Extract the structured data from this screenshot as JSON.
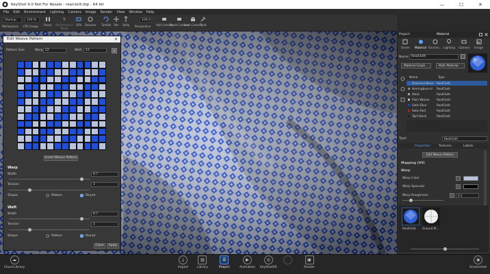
{
  "window": {
    "title": "KeyShot 9.0 Not For Resale - realcloth.bip - 64 bit",
    "minimize": "—",
    "maximize": "☐",
    "close": "✕"
  },
  "menu": [
    "File",
    "Edit",
    "Environment",
    "Lighting",
    "Camera",
    "Image",
    "Render",
    "View",
    "Window",
    "Help"
  ],
  "toolbar": {
    "workspace_value": "Startup",
    "workspace_label": "Workspaces",
    "cpu_value": "100 %",
    "cpu_label": "CPU Usage",
    "pause": "Pause",
    "performance": "Performance Mode",
    "gpu": "GPU",
    "denoise": "Denoise",
    "tumble": "Tumble",
    "pan": "Pan",
    "dolly": "Dolly",
    "fov_value": "100.0",
    "perspective": "Perspective",
    "add_camera": "Add Camera",
    "reset_camera": "Reset Camera",
    "lock_camera": "Lock Camera",
    "tools": "Tools"
  },
  "dialog": {
    "title": "Edit Weave Pattern",
    "close": "✕",
    "pattern_size_label": "Pattern Size",
    "warp_label": "Warp",
    "warp_value": "12",
    "weft_label": "Weft",
    "weft_value": "12",
    "invert_button": "Invert Weave Pattern",
    "warp_section": "Warp",
    "weft_section": "Weft",
    "width_label": "Width",
    "tension_label": "Tension",
    "shape_label": "Shape:",
    "ribbon_label": "Ribbon",
    "round_label": "Round",
    "warp_width_value": "0.7",
    "warp_tension_value": "1",
    "weft_width_value": "0.7",
    "weft_tension_value": "1",
    "close_button": "Close",
    "apply_button": "Apply",
    "grid": [
      [
        1,
        1,
        0,
        0,
        1,
        1,
        0,
        0,
        1,
        1,
        0,
        0
      ],
      [
        1,
        0,
        0,
        1,
        1,
        0,
        0,
        1,
        1,
        0,
        0,
        1
      ],
      [
        0,
        0,
        1,
        1,
        0,
        0,
        1,
        1,
        0,
        0,
        1,
        1
      ],
      [
        0,
        1,
        1,
        0,
        0,
        1,
        1,
        0,
        0,
        1,
        1,
        0
      ],
      [
        1,
        1,
        0,
        0,
        1,
        1,
        0,
        0,
        1,
        1,
        0,
        0
      ],
      [
        1,
        0,
        0,
        1,
        1,
        0,
        0,
        1,
        1,
        0,
        0,
        1
      ],
      [
        0,
        0,
        1,
        1,
        0,
        0,
        1,
        1,
        0,
        0,
        1,
        1
      ],
      [
        0,
        1,
        1,
        0,
        0,
        1,
        1,
        0,
        0,
        1,
        1,
        0
      ],
      [
        1,
        1,
        0,
        0,
        1,
        1,
        0,
        0,
        1,
        1,
        0,
        0
      ],
      [
        1,
        0,
        0,
        1,
        1,
        0,
        0,
        1,
        1,
        0,
        0,
        1
      ],
      [
        0,
        0,
        1,
        1,
        0,
        0,
        1,
        1,
        0,
        0,
        1,
        1
      ],
      [
        0,
        1,
        1,
        0,
        0,
        1,
        1,
        0,
        0,
        1,
        1,
        0
      ]
    ]
  },
  "panel": {
    "project_tab": "Project",
    "material_tab": "Material",
    "tabs": [
      "Scene",
      "Material",
      "Environ...",
      "Lighting",
      "Camera",
      "Image"
    ],
    "name_label": "Name:",
    "name_value": "RealCloth",
    "material_graph": "Material Graph",
    "multi_material": "Multi Material",
    "col_name": "Name",
    "col_type": "Type",
    "materials": [
      {
        "name": "Diamond Wave",
        "type": "RealCloth"
      },
      {
        "name": "Herringbone-V",
        "type": "RealCloth"
      },
      {
        "name": "Mesh",
        "type": "RealCloth"
      },
      {
        "name": "Plain Weave",
        "type": "RealCloth"
      },
      {
        "name": "Satin Blue",
        "type": "RealCloth"
      },
      {
        "name": "Satin Red",
        "type": "RealCloth"
      },
      {
        "name": "Twill Black",
        "type": "RealCloth"
      }
    ],
    "material_colors": [
      "#2f62d8",
      "#8a8a8a",
      "#aaaaaa",
      "#c0c0c0",
      "#2040c0",
      "#c02020",
      "#222222"
    ],
    "type_label": "Type:",
    "type_value": "RealCloth",
    "sub_tabs": [
      "Properties",
      "Textures",
      "Labels"
    ],
    "edit_weave_button": "Edit Weave Pattern",
    "mapping_label": "Mapping (UV)",
    "warp_label": "Warp",
    "warp_color_label": "Warp Color",
    "warp_color": "#b9c4dc",
    "warp_specular_label": "Warp Specular",
    "warp_specular_color": "#050505",
    "warp_roughness_label": "Warp Roughness",
    "warp_roughness_value": "0.1",
    "thumb1": "RealCloth",
    "thumb2": "Ground M..."
  },
  "bottombar": {
    "cloud_library": "Cloud Library",
    "import": "Import",
    "library": "Library",
    "project": "Project",
    "animation": "Animation",
    "keyshotxr": "KeyShotXR",
    "blank": "",
    "render": "Render",
    "screenshot": "Screenshot"
  },
  "colors": {
    "accent": "#2f62d8",
    "weave_blue": "#1f4fdb",
    "weave_light": "#b9c4dc"
  }
}
